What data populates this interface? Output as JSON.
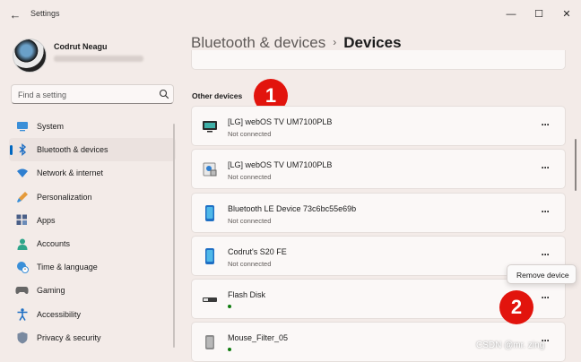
{
  "window": {
    "title": "Settings",
    "back_icon": "arrow-left-icon"
  },
  "user": {
    "name": "Codrut Neagu"
  },
  "search": {
    "placeholder": "Find a setting"
  },
  "nav": {
    "items": [
      {
        "label": "System",
        "icon": "monitor-icon",
        "active": false
      },
      {
        "label": "Bluetooth & devices",
        "icon": "bluetooth-icon",
        "active": true
      },
      {
        "label": "Network & internet",
        "icon": "wifi-icon",
        "active": false
      },
      {
        "label": "Personalization",
        "icon": "brush-icon",
        "active": false
      },
      {
        "label": "Apps",
        "icon": "apps-icon",
        "active": false
      },
      {
        "label": "Accounts",
        "icon": "person-icon",
        "active": false
      },
      {
        "label": "Time & language",
        "icon": "globe-clock-icon",
        "active": false
      },
      {
        "label": "Gaming",
        "icon": "gamepad-icon",
        "active": false
      },
      {
        "label": "Accessibility",
        "icon": "accessibility-icon",
        "active": false
      },
      {
        "label": "Privacy & security",
        "icon": "shield-icon",
        "active": false
      }
    ]
  },
  "breadcrumb": {
    "parent": "Bluetooth & devices",
    "separator": "›",
    "current": "Devices"
  },
  "section": {
    "title": "Other devices"
  },
  "markers": {
    "first": "1",
    "second": "2"
  },
  "devices": [
    {
      "name": "[LG] webOS TV UM7100PLB",
      "status": "Not connected",
      "icon": "tv-icon",
      "more": "···"
    },
    {
      "name": "[LG] webOS TV UM7100PLB",
      "status": "Not connected",
      "icon": "media-device-icon",
      "more": "···"
    },
    {
      "name": "Bluetooth LE Device 73c6bc55e69b",
      "status": "Not connected",
      "icon": "phone-icon",
      "more": "···"
    },
    {
      "name": "Codrut's S20 FE",
      "status": "Not connected",
      "icon": "phone-icon",
      "more": "···"
    },
    {
      "name": "Flash Disk",
      "status": "",
      "icon": "usb-drive-icon",
      "more": "···"
    },
    {
      "name": "Mouse_Filter_05",
      "status": "",
      "icon": "generic-device-icon",
      "more": "···"
    }
  ],
  "context_menu": {
    "item": "Remove device"
  },
  "watermark": "CSDN @mr. zing",
  "colors": {
    "accent": "#0067c0",
    "marker": "#e2140d",
    "connected": "#107c10",
    "background": "#f3ebe8"
  }
}
